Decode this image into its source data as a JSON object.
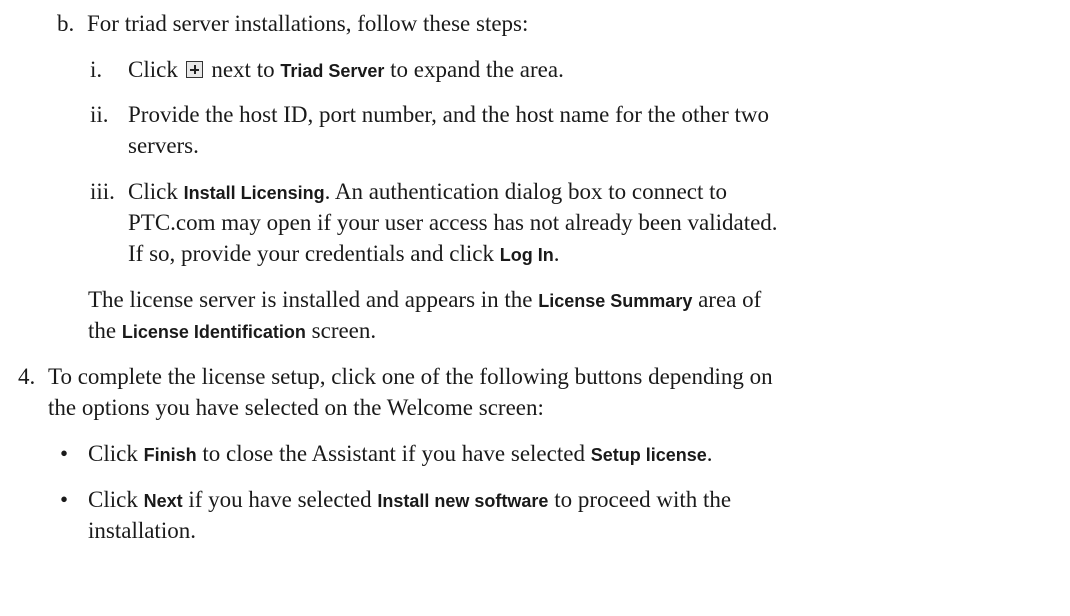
{
  "step_b": {
    "marker": "b.",
    "text": "For triad server installations, follow these steps:",
    "sub_i": {
      "marker": "i.",
      "pre": "Click ",
      "icon": "expand-plus-icon",
      "mid": " next to ",
      "bold": "Triad Server",
      "post": " to expand the area."
    },
    "sub_ii": {
      "marker": "ii.",
      "line1": "Provide the host ID, port number, and the host name for the other two",
      "line2": "servers."
    },
    "sub_iii": {
      "marker": "iii.",
      "l1_pre": "Click ",
      "l1_bold": "Install Licensing",
      "l1_post": ". An authentication dialog box to connect to",
      "line2": "PTC.com may open if your user access has not already been validated.",
      "l3_pre": "If so, provide your credentials and click ",
      "l3_bold": "Log In",
      "l3_post": "."
    },
    "result": {
      "l1_pre": "The license server is installed and appears in the ",
      "l1_bold": "License Summary",
      "l1_post": " area of",
      "l2_pre": "the ",
      "l2_bold": "License Identification",
      "l2_post": " screen."
    }
  },
  "step_4": {
    "marker": "4.",
    "line1": "To complete the license setup, click one of the following buttons depending on",
    "line2": "the options you have selected on the Welcome screen:",
    "bullet_char": "•",
    "bullet1": {
      "pre": "Click ",
      "bold1": "Finish",
      "mid": " to close the Assistant if you have selected ",
      "bold2": "Setup license",
      "post": "."
    },
    "bullet2": {
      "pre": "Click ",
      "bold1": "Next",
      "mid": " if you have selected ",
      "bold2": "Install new software",
      "post": " to proceed with the",
      "line2": "installation."
    }
  }
}
